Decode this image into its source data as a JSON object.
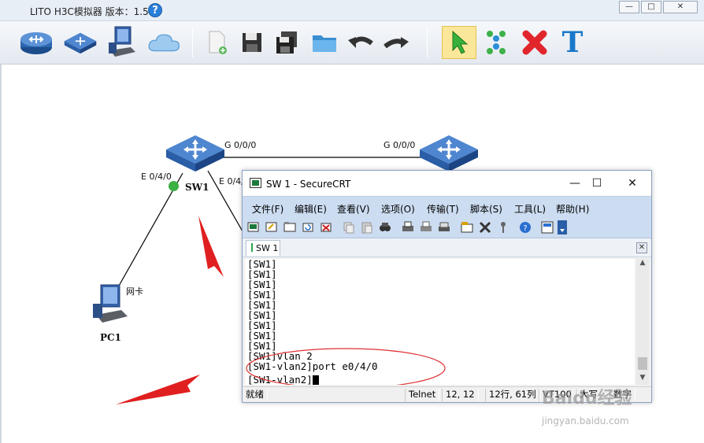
{
  "window": {
    "title": "LITO H3C模拟器 版本：1.5.2",
    "help_glyph": "?"
  },
  "toolbar": {
    "items": [
      {
        "name": "router"
      },
      {
        "name": "switch"
      },
      {
        "name": "pc"
      },
      {
        "name": "cloud"
      },
      {
        "name": "new-file"
      },
      {
        "name": "save"
      },
      {
        "name": "save-as"
      },
      {
        "name": "open-folder"
      },
      {
        "name": "undo"
      },
      {
        "name": "redo"
      },
      {
        "name": "select-pointer"
      },
      {
        "name": "connect"
      },
      {
        "name": "delete"
      },
      {
        "name": "text"
      }
    ],
    "text_tool_glyph": "T"
  },
  "topology": {
    "sw1": {
      "label": "SW1",
      "status_color": "#3cb043"
    },
    "sw2": {
      "label": ""
    },
    "pc1": {
      "label": "PC1",
      "nic_label": "网卡"
    },
    "ports": {
      "sw1_g": "G 0/0/0",
      "sw2_g": "G 0/0/0",
      "sw1_e_left": "E 0/4/0",
      "sw1_e_right": "E 0/4/"
    },
    "arrow_color": "#e02020",
    "highlight_color": "#e03030"
  },
  "securecrt": {
    "title": "SW 1 - SecureCRT",
    "controls": {
      "minimize": "—",
      "maximize": "☐",
      "close": "✕"
    },
    "menu": [
      "文件(F)",
      "编辑(E)",
      "查看(V)",
      "选项(O)",
      "传输(T)",
      "脚本(S)",
      "工具(L)",
      "帮助(H)"
    ],
    "tab_label": "SW 1",
    "tab_close": "✕",
    "terminal_lines": [
      "[SW1]",
      "[SW1]",
      "[SW1]",
      "[SW1]",
      "[SW1]",
      "[SW1]",
      "[SW1]",
      "[SW1]",
      "[SW1]",
      "[SW1]vlan 2",
      "[SW1-vlan2]port e0/4/0",
      "[SW1-vlan2]"
    ],
    "status": {
      "ready": "就绪",
      "protocol": "Telnet",
      "cursor_pos": "12, 12",
      "rows_cols": "12行, 61列",
      "terminal_type": "VT100",
      "caps": "大写",
      "num": "数字"
    }
  },
  "watermark": {
    "brand": "Baidu经验",
    "url": "jingyan.baidu.com"
  }
}
